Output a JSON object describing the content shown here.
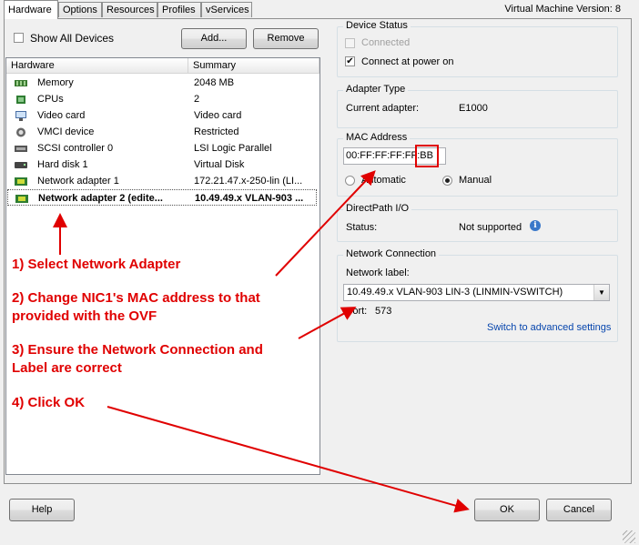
{
  "tabs": [
    "Hardware",
    "Options",
    "Resources",
    "Profiles",
    "vServices"
  ],
  "vm_version": "Virtual Machine Version: 8",
  "show_all_devices": "Show All Devices",
  "add_button": "Add...",
  "remove_button": "Remove",
  "table": {
    "headers": [
      "Hardware",
      "Summary"
    ],
    "rows": [
      {
        "name": "Memory",
        "summary": "2048 MB",
        "icon": "memory-icon"
      },
      {
        "name": "CPUs",
        "summary": "2",
        "icon": "cpu-icon"
      },
      {
        "name": "Video card",
        "summary": "Video card",
        "icon": "monitor-icon"
      },
      {
        "name": "VMCI device",
        "summary": "Restricted",
        "icon": "vmci-icon"
      },
      {
        "name": "SCSI controller 0",
        "summary": "LSI Logic Parallel",
        "icon": "scsi-icon"
      },
      {
        "name": "Hard disk 1",
        "summary": "Virtual Disk",
        "icon": "disk-icon"
      },
      {
        "name": "Network adapter 1",
        "summary": "172.21.47.x-250-lin (LI...",
        "icon": "nic-icon"
      },
      {
        "name": "Network adapter 2 (edite...",
        "summary": "10.49.49.x VLAN-903 ...",
        "icon": "nic-icon"
      }
    ]
  },
  "device_status": {
    "title": "Device Status",
    "connected": "Connected",
    "connect_at_power_on": "Connect at power on"
  },
  "adapter_type": {
    "title": "Adapter Type",
    "label": "Current adapter:",
    "value": "E1000"
  },
  "mac": {
    "title": "MAC Address",
    "value": "00:FF:FF:FF:FF:BB",
    "automatic": "Automatic",
    "manual": "Manual"
  },
  "directpath": {
    "title": "DirectPath I/O",
    "label": "Status:",
    "value": "Not supported"
  },
  "network": {
    "title": "Network Connection",
    "label": "Network label:",
    "value": "10.49.49.x VLAN-903 LIN-3 (LINMIN-VSWITCH)",
    "port_label": "Port:",
    "port_value": "573",
    "advanced_link": "Switch to advanced settings"
  },
  "annotations": {
    "a1": "1) Select Network Adapter",
    "a2_line1": "2) Change NIC1's MAC address to that",
    "a2_line2": "provided with the OVF",
    "a3_line1": "3) Ensure the Network Connection and",
    "a3_line2": "Label are correct",
    "a4": "4) Click OK"
  },
  "help_button": "Help",
  "ok_button": "OK",
  "cancel_button": "Cancel",
  "colors": {
    "annotation": "#e00000",
    "link": "#0645ad"
  }
}
